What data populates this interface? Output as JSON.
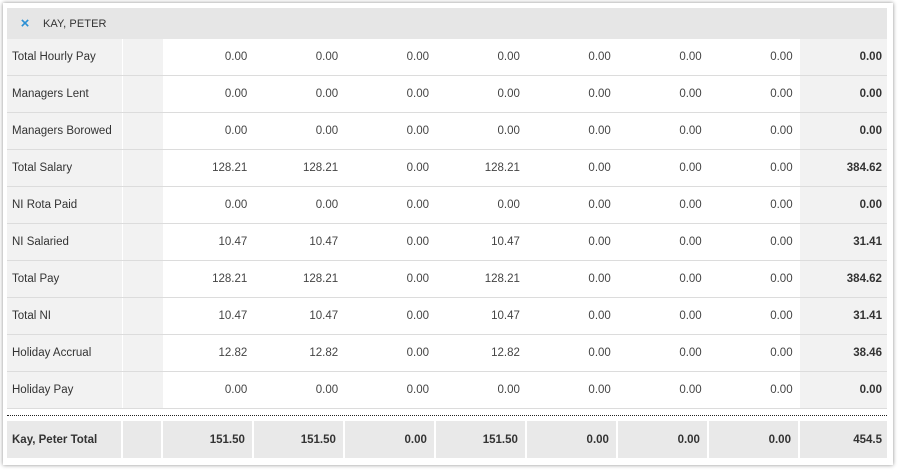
{
  "header": {
    "close_icon": "×",
    "title": "KAY, PETER"
  },
  "rows": [
    {
      "label": "Total Hourly Pay",
      "values": [
        "0.00",
        "0.00",
        "0.00",
        "0.00",
        "0.00",
        "0.00",
        "0.00"
      ],
      "total": "0.00"
    },
    {
      "label": "Managers Lent",
      "values": [
        "0.00",
        "0.00",
        "0.00",
        "0.00",
        "0.00",
        "0.00",
        "0.00"
      ],
      "total": "0.00"
    },
    {
      "label": "Managers Borowed",
      "values": [
        "0.00",
        "0.00",
        "0.00",
        "0.00",
        "0.00",
        "0.00",
        "0.00"
      ],
      "total": "0.00"
    },
    {
      "label": "Total Salary",
      "values": [
        "128.21",
        "128.21",
        "0.00",
        "128.21",
        "0.00",
        "0.00",
        "0.00"
      ],
      "total": "384.62"
    },
    {
      "label": "NI Rota Paid",
      "values": [
        "0.00",
        "0.00",
        "0.00",
        "0.00",
        "0.00",
        "0.00",
        "0.00"
      ],
      "total": "0.00"
    },
    {
      "label": "NI Salaried",
      "values": [
        "10.47",
        "10.47",
        "0.00",
        "10.47",
        "0.00",
        "0.00",
        "0.00"
      ],
      "total": "31.41"
    },
    {
      "label": "Total Pay",
      "values": [
        "128.21",
        "128.21",
        "0.00",
        "128.21",
        "0.00",
        "0.00",
        "0.00"
      ],
      "total": "384.62"
    },
    {
      "label": "Total NI",
      "values": [
        "10.47",
        "10.47",
        "0.00",
        "10.47",
        "0.00",
        "0.00",
        "0.00"
      ],
      "total": "31.41"
    },
    {
      "label": "Holiday Accrual",
      "values": [
        "12.82",
        "12.82",
        "0.00",
        "12.82",
        "0.00",
        "0.00",
        "0.00"
      ],
      "total": "38.46"
    },
    {
      "label": "Holiday Pay",
      "values": [
        "0.00",
        "0.00",
        "0.00",
        "0.00",
        "0.00",
        "0.00",
        "0.00"
      ],
      "total": "0.00"
    }
  ],
  "total_row": {
    "label": "Kay, Peter Total",
    "values": [
      "151.50",
      "151.50",
      "0.00",
      "151.50",
      "0.00",
      "0.00",
      "0.00"
    ],
    "total": "454.5"
  },
  "colors": {
    "accent": "#2a8fd4",
    "header_bg": "#e6e6e6",
    "label_bg": "#f2f2f2"
  }
}
